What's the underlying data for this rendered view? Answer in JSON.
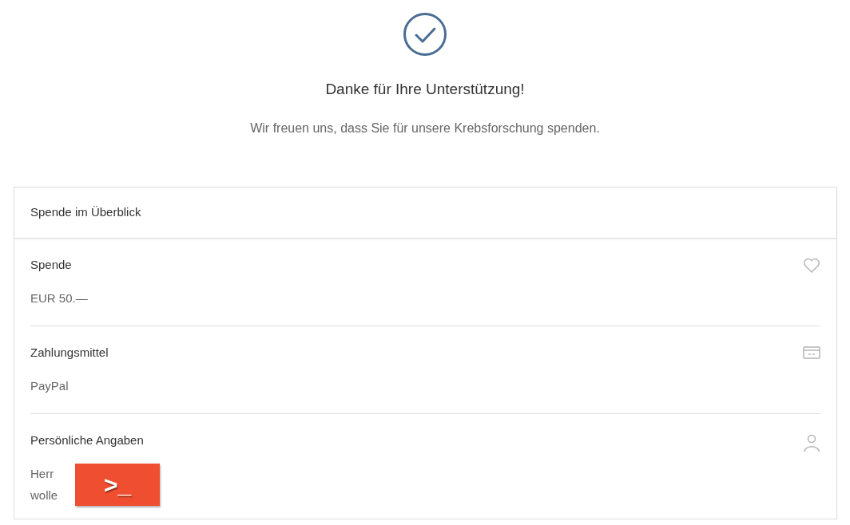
{
  "confirmation": {
    "title": "Danke für Ihre Unterstützung!",
    "message": "Wir freuen uns, dass Sie für unsere Krebsforschung spenden."
  },
  "summary": {
    "title": "Spende im Überblick",
    "sections": [
      {
        "kind": "heart",
        "title": "Spende",
        "lines": [
          "EUR 50.—"
        ]
      },
      {
        "kind": "card",
        "title": "Zahlungsmittel",
        "lines": [
          "PayPal"
        ]
      },
      {
        "kind": "person",
        "title": "Persönliche Angaben",
        "lines": [
          "Herr",
          "wolle"
        ]
      }
    ]
  },
  "overlay_badge": {
    "text": ">_"
  }
}
